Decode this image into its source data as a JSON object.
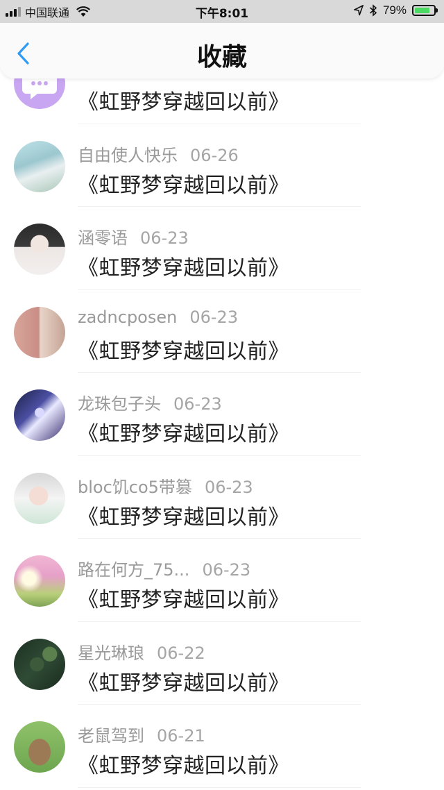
{
  "status_bar": {
    "carrier": "中国联通",
    "time": "下午8:01",
    "battery": "79%",
    "battery_level": 0.79
  },
  "nav": {
    "title": "收藏"
  },
  "items": [
    {
      "user": "",
      "date": "",
      "title": "《虹野梦穿越回以前》",
      "avatar_icon": "chat-bubble-avatar"
    },
    {
      "user": "自由使人快乐",
      "date": "06-26",
      "title": "《虹野梦穿越回以前》",
      "avatar_icon": "girl-avatar"
    },
    {
      "user": "涵零语",
      "date": "06-23",
      "title": "《虹野梦穿越回以前》",
      "avatar_icon": "boy-avatar"
    },
    {
      "user": "zadncposen",
      "date": "06-23",
      "title": "《虹野梦穿越回以前》",
      "avatar_icon": "two-girls-avatar"
    },
    {
      "user": "龙珠包子头",
      "date": "06-23",
      "title": "《虹野梦穿越回以前》",
      "avatar_icon": "anime-avatar"
    },
    {
      "user": "bloc饥co5带篡",
      "date": "06-23",
      "title": "《虹野梦穿越回以前》",
      "avatar_icon": "face-avatar"
    },
    {
      "user": "路在何方_75...",
      "date": "06-23",
      "title": "《虹野梦穿越回以前》",
      "avatar_icon": "sunset-avatar"
    },
    {
      "user": "星光琳琅",
      "date": "06-22",
      "title": "《虹野梦穿越回以前》",
      "avatar_icon": "forest-avatar"
    },
    {
      "user": "老鼠驾到",
      "date": "06-21",
      "title": "《虹野梦穿越回以前》",
      "avatar_icon": "mouse-avatar"
    }
  ],
  "colors": {
    "accent": "#2f9bf5",
    "nav_background": "#fafafa",
    "status_background": "#d9d9d9",
    "meta_text": "#9a9a9a",
    "title_text": "#222222",
    "battery_fill": "#4cd964"
  }
}
